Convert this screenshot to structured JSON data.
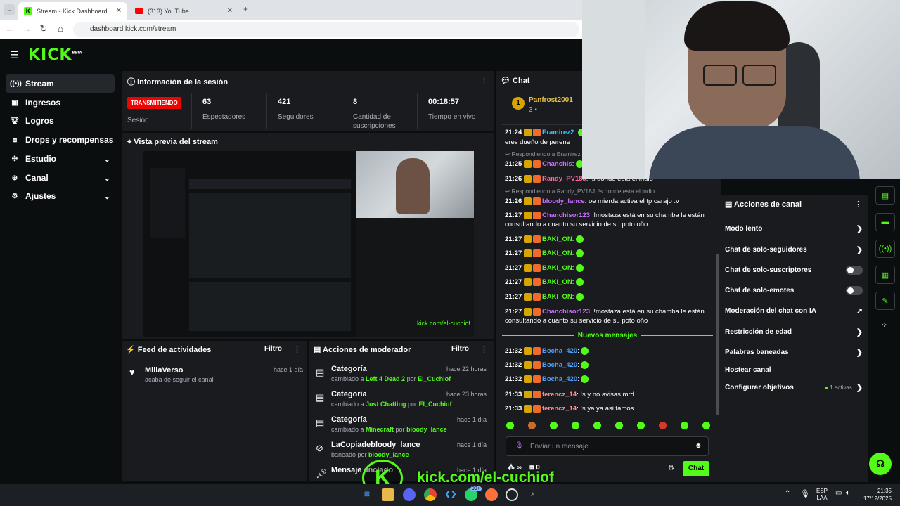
{
  "browser": {
    "tabs": [
      {
        "title": "Stream - Kick Dashboard",
        "active": true
      },
      {
        "title": "(313) YouTube",
        "active": false
      }
    ],
    "url": "dashboard.kick.com/stream"
  },
  "app": {
    "logo": "KICK",
    "logo_sup": "BETA",
    "brand_color": "#53fc18"
  },
  "sidebar": {
    "items": [
      {
        "label": "Stream",
        "icon": "broadcast-icon",
        "selected": true
      },
      {
        "label": "Ingresos",
        "icon": "money-icon"
      },
      {
        "label": "Logros",
        "icon": "trophy-icon"
      },
      {
        "label": "Drops y recompensas",
        "icon": "gift-icon"
      },
      {
        "label": "Estudio",
        "icon": "studio-icon",
        "chevron": true
      },
      {
        "label": "Canal",
        "icon": "channel-icon",
        "chevron": true
      },
      {
        "label": "Ajustes",
        "icon": "gear-icon",
        "chevron": true
      }
    ]
  },
  "session": {
    "title": "Información de la sesión",
    "live_badge": "TRANSMITIENDO",
    "live_label": "Sesión",
    "stats": [
      {
        "value": "63",
        "label": "Espectadores"
      },
      {
        "value": "421",
        "label": "Seguidores"
      },
      {
        "value": "8",
        "label": "Cantidad de suscripciones"
      },
      {
        "value": "00:18:57",
        "label": "Tiempo en vivo"
      }
    ]
  },
  "preview": {
    "title": "Vista previa del stream"
  },
  "activity": {
    "title": "Feed de actividades",
    "filter": "Filtro",
    "items": [
      {
        "name": "MillaVerso",
        "desc": "acaba de seguir el canal",
        "time": "hace 1 día"
      }
    ]
  },
  "modactions": {
    "title": "Acciones de moderador",
    "filter": "Filtro",
    "items": [
      {
        "title": "Categoría",
        "pre": "cambiado a ",
        "hl1": "Left 4 Dead 2",
        "mid": " por ",
        "hl2": "El_Cuchiof",
        "time": "hace 22 horas"
      },
      {
        "title": "Categoría",
        "pre": "cambiado a ",
        "hl1": "Just Chatting",
        "mid": " por ",
        "hl2": "El_Cuchiof",
        "time": "hace 23 horas"
      },
      {
        "title": "Categoría",
        "pre": "cambiado a ",
        "hl1": "Minecraft",
        "mid": " por ",
        "hl2": "bloody_lance",
        "time": "hace 1 día"
      },
      {
        "title": "LaCopiadebloody_lance",
        "pre": "baneado por ",
        "hl1": "bloody_lance",
        "mid": "",
        "hl2": "",
        "time": "hace 1 día"
      },
      {
        "title": "Mensaje anclado",
        "pre": "",
        "hl1": "",
        "mid": "",
        "hl2": "",
        "time": "hace 1 día"
      }
    ]
  },
  "chat": {
    "title": "Chat",
    "pinned_user": "Panfrost2001",
    "pinned_count": "3",
    "new_messages": "Nuevos mensajes",
    "input_placeholder": "Enviar un mensaje",
    "send_label": "Chat",
    "followers_count": "∞",
    "gift_count": "0",
    "messages": [
      {
        "time": "21:24",
        "user": "Eramirez2",
        "color": "#33c5ff",
        "text": ""
      },
      {
        "time": "",
        "user": "",
        "color": "",
        "text": "eres dueño de perene"
      },
      {
        "reply": "Respondiendo a Eramirez"
      },
      {
        "time": "21:25",
        "user": "Chanchis",
        "color": "#c96cff",
        "text": ""
      },
      {
        "time": "21:26",
        "user": "Randy_PV18J",
        "color": "#ff6b9a",
        "text": "!s donde esta el indio"
      },
      {
        "reply": "Respondiendo a Randy_PV18J: !s donde esta el indio"
      },
      {
        "time": "21:26",
        "user": "bloody_lance",
        "color": "#c96cff",
        "text": "oe mierda activa el tp carajo :v"
      },
      {
        "time": "21:27",
        "user": "Chanchisor123",
        "color": "#c96cff",
        "text": "!mostaza está en su chamba le están consultando a cuanto su servicio de su poto oño"
      },
      {
        "time": "21:27",
        "user": "BAKI_ON",
        "color": "#53fc18",
        "text": ""
      },
      {
        "time": "21:27",
        "user": "BAKI_ON",
        "color": "#53fc18",
        "text": ""
      },
      {
        "time": "21:27",
        "user": "BAKI_ON",
        "color": "#53fc18",
        "text": ""
      },
      {
        "time": "21:27",
        "user": "BAKI_ON",
        "color": "#53fc18",
        "text": ""
      },
      {
        "time": "21:27",
        "user": "BAKI_ON",
        "color": "#53fc18",
        "text": ""
      },
      {
        "time": "21:27",
        "user": "Chanchisor123",
        "color": "#c96cff",
        "text": "!mostaza está en su chamba le están consultando a cuanto su servicio de su poto oño"
      },
      {
        "time": "21:32",
        "user": "Bocha_420",
        "color": "#4fa3ff",
        "text": ""
      },
      {
        "time": "21:32",
        "user": "Bocha_420",
        "color": "#4fa3ff",
        "text": ""
      },
      {
        "time": "21:32",
        "user": "Bocha_420",
        "color": "#4fa3ff",
        "text": ""
      },
      {
        "time": "21:33",
        "user": "ferencz_14",
        "color": "#ff8a8a",
        "text": "!s y no avisas mrd"
      },
      {
        "time": "21:33",
        "user": "ferencz_14",
        "color": "#ff8a8a",
        "text": "!s ya ya asi tamos"
      }
    ]
  },
  "channel_actions": {
    "title": "Acciones de canal",
    "items": [
      {
        "label": "Modo lento",
        "kind": "chevron"
      },
      {
        "label": "Chat de solo-seguidores",
        "kind": "chevron"
      },
      {
        "label": "Chat de solo-suscriptores",
        "kind": "toggle"
      },
      {
        "label": "Chat de solo-emotes",
        "kind": "toggle"
      },
      {
        "label": "Moderación del chat con IA",
        "kind": "external"
      },
      {
        "label": "Restricción de edad",
        "kind": "chevron"
      },
      {
        "label": "Palabras baneadas",
        "kind": "chevron"
      },
      {
        "label": "Hostear canal",
        "kind": "none"
      },
      {
        "label": "Configurar objetivos",
        "kind": "chevron",
        "extra": "1 activas"
      }
    ]
  },
  "overlay": {
    "logo": "K",
    "text": "kick.com/el-cuchiof"
  },
  "taskbar": {
    "lang": "ESP",
    "region": "LAA",
    "time": "21:35",
    "date": "17/12/2025",
    "whatsapp_badge": "99+"
  }
}
